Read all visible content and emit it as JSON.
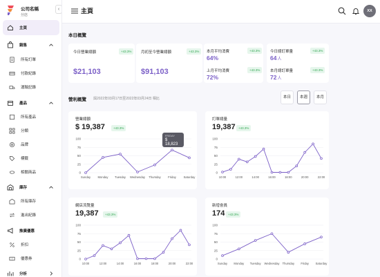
{
  "brand": {
    "name": "公司名稱",
    "sub": "分店"
  },
  "header": {
    "title": "主頁",
    "avatar": "XX"
  },
  "sidebar": {
    "home": "主頁",
    "sales": {
      "label": "銷售",
      "items": [
        "所有訂單",
        "付款紀錄",
        "運輸記錄"
      ]
    },
    "products": {
      "label": "產品",
      "items": [
        "所有產品",
        "分類",
        "品牌",
        "標籤",
        "相關商品"
      ]
    },
    "inventory": {
      "label": "庫存",
      "items": [
        "所有庫存",
        "進出紀錄"
      ]
    },
    "promotion": {
      "label": "推廣優惠",
      "items": [
        "折扣",
        "優惠券"
      ]
    },
    "analytics": {
      "label": "分析"
    }
  },
  "today": {
    "title": "本日概覽",
    "kpis": [
      {
        "label": "今日營業總額",
        "badge": "+43.3%",
        "value": "$21,103"
      },
      {
        "label": "月初至今營業總額",
        "badge": "+43.3%",
        "value": "$91,103"
      },
      {
        "label": "本月平均消費",
        "badge": "+43.3%",
        "value": "64%"
      },
      {
        "label": "上月平均消費",
        "badge": "+43.3%",
        "value": "72%"
      },
      {
        "label": "今日總訂單量",
        "badge": "+43.3%",
        "value": "64",
        "unit": "人"
      },
      {
        "label": "本月總訂單量",
        "badge": "+43.3%",
        "value": "72",
        "unit": "人"
      }
    ]
  },
  "performance": {
    "title": "營利概覽",
    "range": "與2022年03月17日至2022年03月24日 相比",
    "segments": [
      "本日",
      "本週",
      "本月"
    ],
    "active_segment": "本週"
  },
  "colors": {
    "accent": "#7b5fc7",
    "badge_bg": "#e6f6ec",
    "badge_text": "#34a853"
  },
  "charts": [
    {
      "label": "營業總額",
      "value": "$ 19,387",
      "badge": "+43.3%",
      "tooltip": {
        "day": "FRIDAY",
        "value": "$ 18,823"
      }
    },
    {
      "label": "訂單總量",
      "value": "19,387",
      "badge": "+43.3%"
    },
    {
      "label": "網店流覽量",
      "value": "19,387",
      "badge": "+43.3%"
    },
    {
      "label": "新增會員",
      "value": "174",
      "badge": "+43.3%"
    }
  ],
  "chart_data": [
    {
      "type": "line",
      "title": "營業總額",
      "x": [
        "Sunday",
        "Monday",
        "Tuesday",
        "Wednesday",
        "Thursday",
        "Friday",
        "Saturday"
      ],
      "y": [
        0,
        45,
        55,
        2,
        23,
        67,
        44
      ],
      "ylim": [
        0,
        100
      ],
      "yticks": [
        0,
        25,
        50,
        75,
        100
      ],
      "grid": true
    },
    {
      "type": "line",
      "title": "訂單總量",
      "x": [
        "10:00",
        "11:00",
        "12:00",
        "13:00",
        "14:00",
        "15:00",
        "16:00",
        "17:00",
        "18:00",
        "19:00",
        "20:00",
        "21:00",
        "22:00"
      ],
      "y": [
        2,
        10,
        40,
        32,
        48,
        70,
        1,
        1,
        1,
        20,
        60,
        85,
        42
      ],
      "xticks": [
        "10:00",
        "12:00",
        "14:00",
        "16:00",
        "18:00",
        "20:00",
        "22:00"
      ],
      "ylim": [
        0,
        100
      ],
      "yticks": [
        0,
        25,
        50,
        75,
        100
      ],
      "grid": true
    },
    {
      "type": "line",
      "title": "網店流覽量",
      "x": [
        "10:00",
        "11:00",
        "12:00",
        "13:00",
        "14:00",
        "15:00",
        "16:00",
        "17:00",
        "18:00",
        "19:00",
        "20:00",
        "21:00",
        "22:00"
      ],
      "y": [
        0,
        10,
        40,
        30,
        48,
        70,
        1,
        1,
        1,
        20,
        60,
        85,
        42
      ],
      "xticks": [
        "10:00",
        "12:00",
        "14:00",
        "16:00",
        "18:00",
        "20:00",
        "22:00"
      ],
      "ylim": [
        0,
        100
      ],
      "yticks": [
        0,
        25,
        50,
        75,
        100
      ],
      "grid": true
    },
    {
      "type": "line",
      "title": "新增會員",
      "x": [
        "Sunday",
        "Monday",
        "Tuesday",
        "Wednesday",
        "Thursday",
        "Friday",
        "Saturday"
      ],
      "y": [
        10,
        30,
        55,
        75,
        20,
        45,
        65
      ],
      "ylim": [
        0,
        100
      ],
      "yticks": [
        0,
        25,
        50,
        75,
        100
      ],
      "grid": true
    }
  ]
}
